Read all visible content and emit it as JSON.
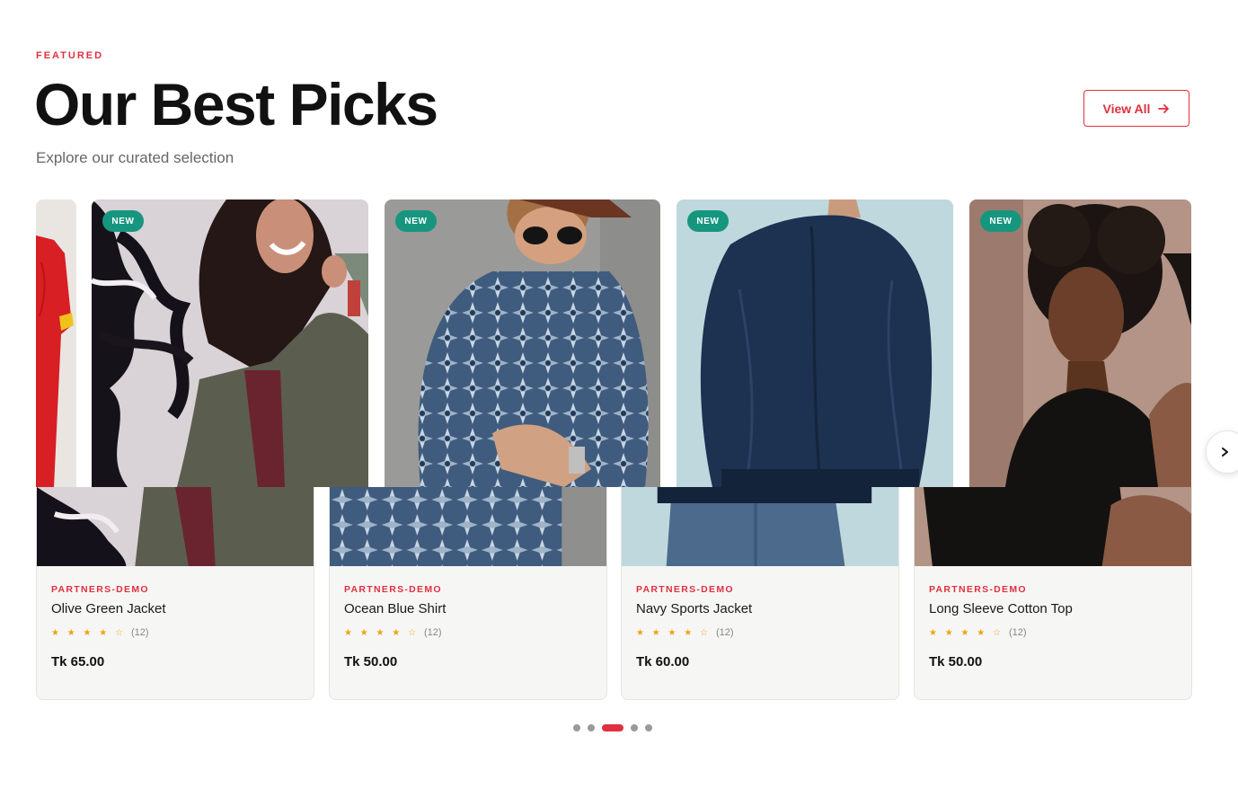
{
  "section": {
    "eyebrow": "FEATURED",
    "title": "Our Best Picks",
    "subtitle": "Explore our curated selection",
    "view_all_label": "View All",
    "view_all_icon": "arrow-right-icon"
  },
  "colors": {
    "accent": "#e0303f",
    "badge": "#17967f",
    "star": "#f2a20c",
    "card_bg": "#f6f6f5"
  },
  "image_cards": [
    {
      "badge": ""
    },
    {
      "badge": "NEW"
    },
    {
      "badge": "NEW"
    },
    {
      "badge": "NEW"
    },
    {
      "badge": "NEW"
    }
  ],
  "products": [
    {
      "vendor": "PARTNERS-DEMO",
      "name": "Olive Green Jacket",
      "stars": "★ ★ ★ ★ ☆",
      "rating": 4,
      "review_count": "(12)",
      "price": "Tk 65.00"
    },
    {
      "vendor": "PARTNERS-DEMO",
      "name": "Ocean Blue Shirt",
      "stars": "★ ★ ★ ★ ☆",
      "rating": 4,
      "review_count": "(12)",
      "price": "Tk 50.00"
    },
    {
      "vendor": "PARTNERS-DEMO",
      "name": "Navy Sports Jacket",
      "stars": "★ ★ ★ ★ ☆",
      "rating": 4,
      "review_count": "(12)",
      "price": "Tk 60.00"
    },
    {
      "vendor": "PARTNERS-DEMO",
      "name": "Long Sleeve Cotton Top",
      "stars": "★ ★ ★ ★ ☆",
      "rating": 4,
      "review_count": "(12)",
      "price": "Tk 50.00"
    }
  ],
  "carousel": {
    "next_icon": "chevron-right-icon",
    "dot_count": 5,
    "active_dot": 3
  }
}
